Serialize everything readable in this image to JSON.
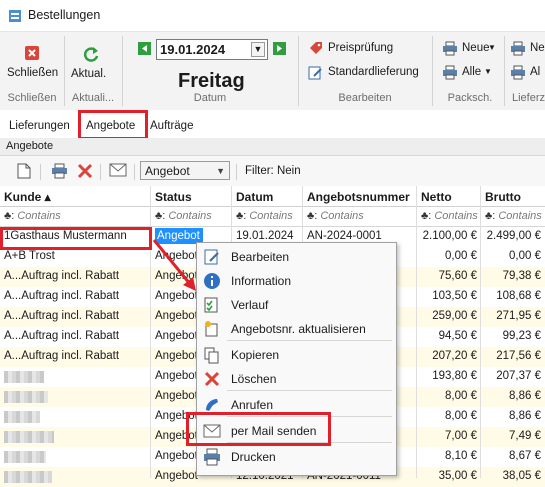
{
  "window": {
    "title": "Bestellungen"
  },
  "ribbon": {
    "close_label": "Schließen",
    "refresh_label": "Aktual.",
    "date_value": "19.01.2024",
    "weekday": "Freitag",
    "price_check_label": "Preisprüfung",
    "standard_delivery_label": "Standardlieferung",
    "print_new_label": "Neue",
    "print_all_label": "Alle",
    "print2_new_label": "Ne",
    "print2_all_label": "Al",
    "groups": {
      "close": "Schließen",
      "refresh": "Aktuali...",
      "date": "Datum",
      "edit": "Bearbeiten",
      "packslip": "Packsch.",
      "delivery": "Lieferz"
    }
  },
  "tabs": [
    {
      "label": "Lieferungen"
    },
    {
      "label": "Angebote",
      "active": true
    },
    {
      "label": "Aufträge"
    }
  ],
  "subtitle": "Angebote",
  "toolbar": {
    "combo_value": "Angebot",
    "filter_text": "Filter: Nein"
  },
  "grid": {
    "columns": [
      "Kunde ▴",
      "Status",
      "Datum",
      "Angebotsnummer",
      "Netto",
      "Brutto"
    ],
    "filter_placeholder": "Contains",
    "filter_prefix": "♣:",
    "rows": [
      {
        "kunde": "1Gasthaus Mustermann",
        "status": "Angebot",
        "datum": "19.01.2024",
        "nummer": "AN-2024-0001",
        "netto": "2.100,00 €",
        "brutto": "2.499,00 €"
      },
      {
        "kunde": "A+B Trost",
        "status": "Angebot",
        "datum": "",
        "nummer": "",
        "netto": "0,00 €",
        "brutto": "0,00 €"
      },
      {
        "kunde": "A...Auftrag incl. Rabatt",
        "status": "Angebot",
        "datum": "",
        "nummer": "",
        "netto": "75,60 €",
        "brutto": "79,38 €"
      },
      {
        "kunde": "A...Auftrag incl. Rabatt",
        "status": "Angebot",
        "datum": "",
        "nummer": "2",
        "netto": "103,50 €",
        "brutto": "108,68 €"
      },
      {
        "kunde": "A...Auftrag incl. Rabatt",
        "status": "Angebot",
        "datum": "",
        "nummer": "3",
        "netto": "259,00 €",
        "brutto": "271,95 €"
      },
      {
        "kunde": "A...Auftrag incl. Rabatt",
        "status": "Angebot",
        "datum": "",
        "nummer": "5",
        "netto": "94,50 €",
        "brutto": "99,23 €"
      },
      {
        "kunde": "A...Auftrag incl. Rabatt",
        "status": "Angebot",
        "datum": "",
        "nummer": "8",
        "netto": "207,20 €",
        "brutto": "217,56 €"
      },
      {
        "kunde": "",
        "status": "Angebot",
        "datum": "",
        "nummer": "",
        "netto": "193,80 €",
        "brutto": "207,37 €"
      },
      {
        "kunde": "",
        "status": "Angebot",
        "datum": "",
        "nummer": "6",
        "netto": "8,00 €",
        "brutto": "8,86 €"
      },
      {
        "kunde": "",
        "status": "Angebot",
        "datum": "",
        "nummer": "8",
        "netto": "8,00 €",
        "brutto": "8,86 €"
      },
      {
        "kunde": "",
        "status": "Angebot",
        "datum": "",
        "nummer": "",
        "netto": "7,00 €",
        "brutto": "7,49 €"
      },
      {
        "kunde": "",
        "status": "Angebot",
        "datum": "",
        "nummer": "",
        "netto": "8,10 €",
        "brutto": "8,67 €"
      },
      {
        "kunde": "",
        "status": "Angebot",
        "datum": "12.10.2021",
        "nummer": "AN-2021-0011",
        "netto": "35,00 €",
        "brutto": "38,05 €"
      }
    ]
  },
  "context_menu": {
    "items": [
      {
        "label": "Bearbeiten",
        "icon": "edit-icon"
      },
      {
        "label": "Information",
        "icon": "info-icon"
      },
      {
        "label": "Verlauf",
        "icon": "history-icon"
      },
      {
        "label": "Angebotsnr. aktualisieren",
        "icon": "renumber-icon"
      },
      {
        "label": "Kopieren",
        "icon": "copy-icon"
      },
      {
        "label": "Löschen",
        "icon": "delete-icon"
      },
      {
        "label": "Anrufen",
        "icon": "phone-icon"
      },
      {
        "label": "per Mail senden",
        "icon": "mail-icon"
      },
      {
        "label": "Drucken",
        "icon": "print-icon"
      }
    ]
  },
  "colors": {
    "accent_red": "#e0202a",
    "selection_blue": "#1e90ff",
    "row_alt": "#fffbe6",
    "nav_green": "#2e9e3f"
  }
}
